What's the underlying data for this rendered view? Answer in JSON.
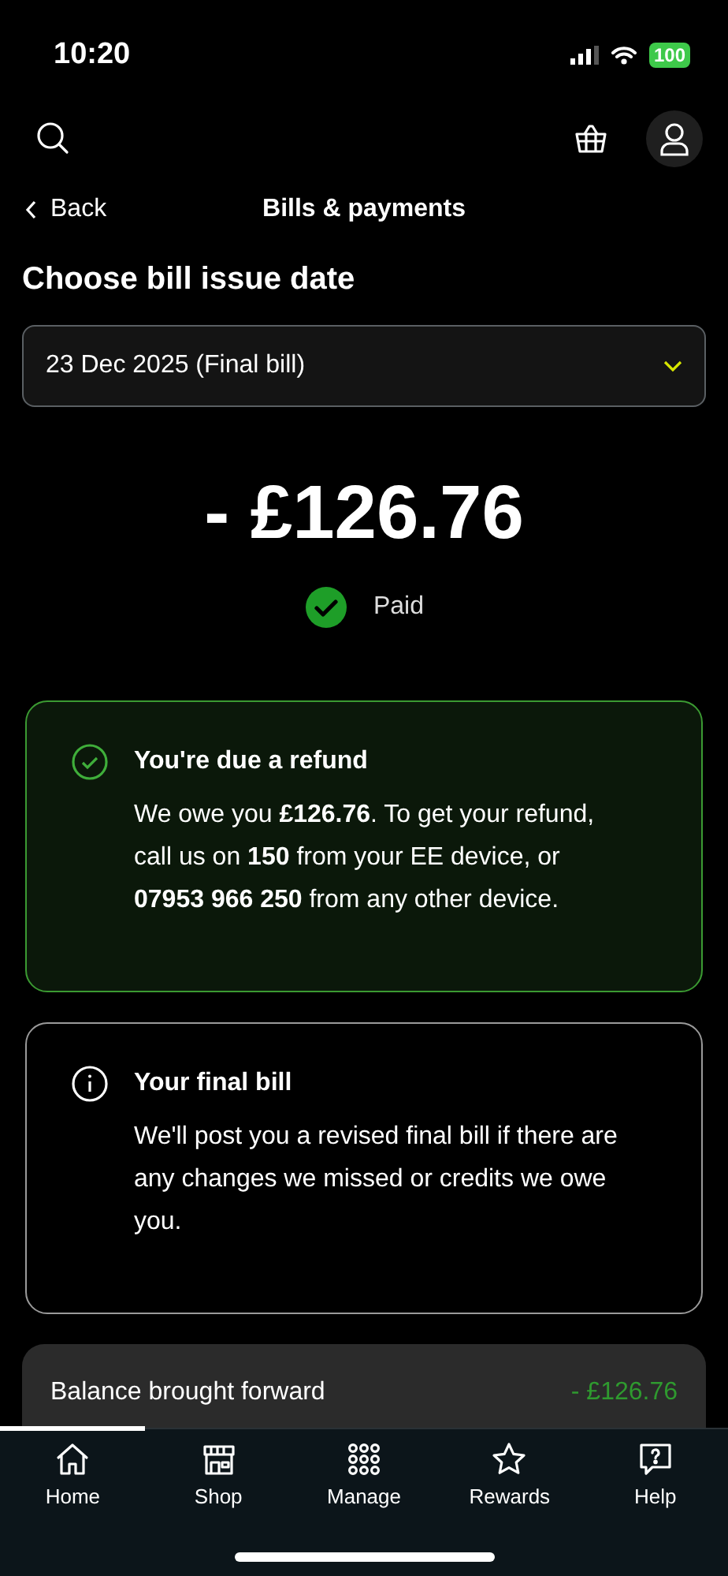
{
  "status_bar": {
    "time": "10:20",
    "battery": "100"
  },
  "header": {
    "back": "Back",
    "title": "Bills & payments"
  },
  "heading": "Choose bill issue date",
  "bill_select": {
    "value": "23 Dec 2025 (Final bill)"
  },
  "amount": "- £126.76",
  "payment_status": {
    "label": "Paid"
  },
  "notices": [
    {
      "kind": "success",
      "title": "You're due a refund",
      "body": "We owe you **£126.76**. To get your refund, call us on **150** from your EE device, or **07953 966 250** from any other device."
    },
    {
      "kind": "info",
      "title": "Your final bill",
      "body": "We'll post you a revised final bill if there are any changes we missed or credits we owe you."
    }
  ],
  "balance": {
    "label": "Balance brought forward",
    "amount": "- £126.76"
  },
  "nav": [
    {
      "label": "Home",
      "selected": true
    },
    {
      "label": "Shop",
      "selected": false
    },
    {
      "label": "Manage",
      "selected": false
    },
    {
      "label": "Rewards",
      "selected": false
    },
    {
      "label": "Help",
      "selected": false
    }
  ]
}
